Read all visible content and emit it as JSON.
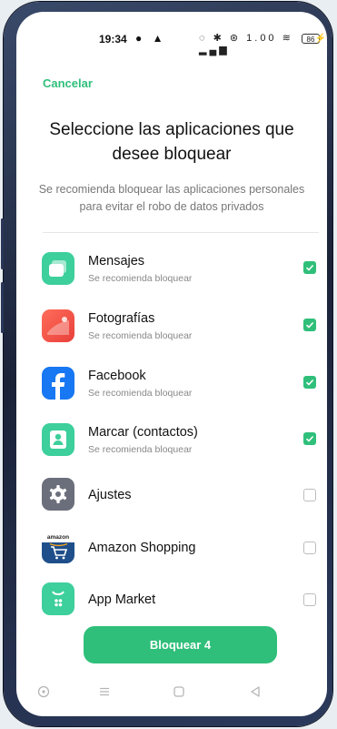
{
  "status_bar": {
    "time": "19:34",
    "left_icons": "● ▲",
    "right_icons": "◌ ✱ ⊛ 1.00 ≋ ▂▄▆",
    "battery": "86"
  },
  "header": {
    "cancel_label": "Cancelar",
    "title": "Seleccione las aplicaciones que desee bloquear",
    "subtitle": "Se recomienda bloquear las aplicaciones personales para evitar el robo de datos privados"
  },
  "apps": [
    {
      "name": "Mensajes",
      "sub": "Se recomienda bloquear",
      "checked": true,
      "icon": "messages-icon",
      "color": "#3dcf9c"
    },
    {
      "name": "Fotografías",
      "sub": "Se recomienda bloquear",
      "checked": true,
      "icon": "photos-icon",
      "color": "#f05a4a"
    },
    {
      "name": "Facebook",
      "sub": "Se recomienda bloquear",
      "checked": true,
      "icon": "facebook-icon",
      "color": "#1877f2"
    },
    {
      "name": "Marcar (contactos)",
      "sub": "Se recomienda bloquear",
      "checked": true,
      "icon": "contacts-icon",
      "color": "#3dcf9c"
    },
    {
      "name": "Ajustes",
      "sub": "",
      "checked": false,
      "icon": "settings-icon",
      "color": "#6b6f7b"
    },
    {
      "name": "Amazon Shopping",
      "sub": "",
      "checked": false,
      "icon": "amazon-icon",
      "color": "#1f4f8a"
    },
    {
      "name": "App Market",
      "sub": "",
      "checked": false,
      "icon": "app-market-icon",
      "color": "#3dcf9c"
    }
  ],
  "action": {
    "lock_label": "Bloquear 4"
  },
  "colors": {
    "accent": "#2fbf7a"
  }
}
